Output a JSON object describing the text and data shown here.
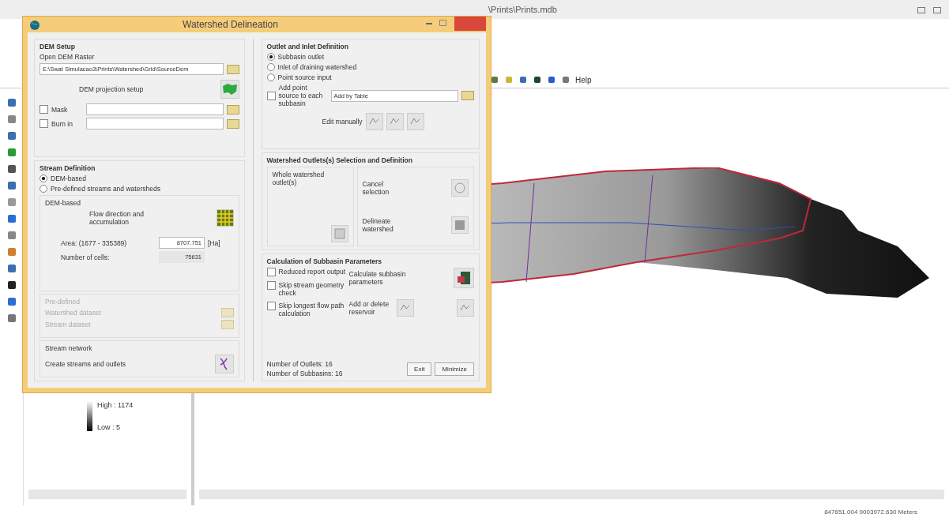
{
  "app": {
    "title": "\\Prints\\Prints.mdb",
    "help": "Help",
    "legend": {
      "high": "High : 1174",
      "low": "Low : 5"
    },
    "status": "847651.004 9003972.630 Meters"
  },
  "dialog": {
    "title": "Watershed Delineation",
    "dem_setup": {
      "heading": "DEM Setup",
      "open_label": "Open DEM Raster",
      "path": "E:\\Swat Simulacao3\\Prints\\Watershed\\Grid\\SourceDem",
      "projection_label": "DEM projection setup",
      "mask": {
        "label": "Mask",
        "checked": false
      },
      "burn_in": {
        "label": "Burn in",
        "checked": false
      }
    },
    "stream_definition": {
      "heading": "Stream Definition",
      "options": [
        {
          "label": "DEM-based",
          "selected": true
        },
        {
          "label": "Pre-defined streams and watersheds",
          "selected": false
        }
      ],
      "dem_based": {
        "heading": "DEM-based",
        "flow_label": "Flow direction and accumulation",
        "area_label": "Area: (1677 - 335389)",
        "area_value": "8707.751",
        "area_unit": "[Ha]",
        "cells_label": "Number of cells:",
        "cells_value": "75631"
      },
      "pre_defined": {
        "heading": "Pre-defined",
        "disabled": true,
        "watershed_label": "Watershed dataset",
        "stream_label": "Stream dataset"
      },
      "network": {
        "heading": "Stream network",
        "label": "Create streams and outlets"
      }
    },
    "outlet": {
      "heading": "Outlet and Inlet Definition",
      "options": [
        {
          "label": "Subbasin outlet",
          "selected": true
        },
        {
          "label": "Inlet of draining watershed",
          "selected": false
        },
        {
          "label": "Point source input",
          "selected": false
        }
      ],
      "add_point": {
        "label": "Add point source to each subbasin",
        "checked": false
      },
      "add_by": "Add by Table",
      "edit_label": "Edit manually"
    },
    "selection": {
      "heading": "Watershed Outlets(s) Selection and Definition",
      "whole": "Whole watershed outlet(s)",
      "cancel": "Cancel selection",
      "delineate": "Delineate watershed"
    },
    "calculation": {
      "heading": "Calculation of Subbasin Parameters",
      "options": [
        {
          "label": "Reduced report output",
          "checked": false
        },
        {
          "label": "Skip stream geometry check",
          "checked": false
        },
        {
          "label": "Skip longest flow path calculation",
          "checked": false
        }
      ],
      "calculate": "Calculate subbasin parameters",
      "reservoir": "Add or delete reservoir"
    },
    "outlets_count": "Number of Outlets: 16",
    "subbasins_count": "Number of Subbasins: 16",
    "buttons": [
      "Exit",
      "Minimize"
    ]
  }
}
